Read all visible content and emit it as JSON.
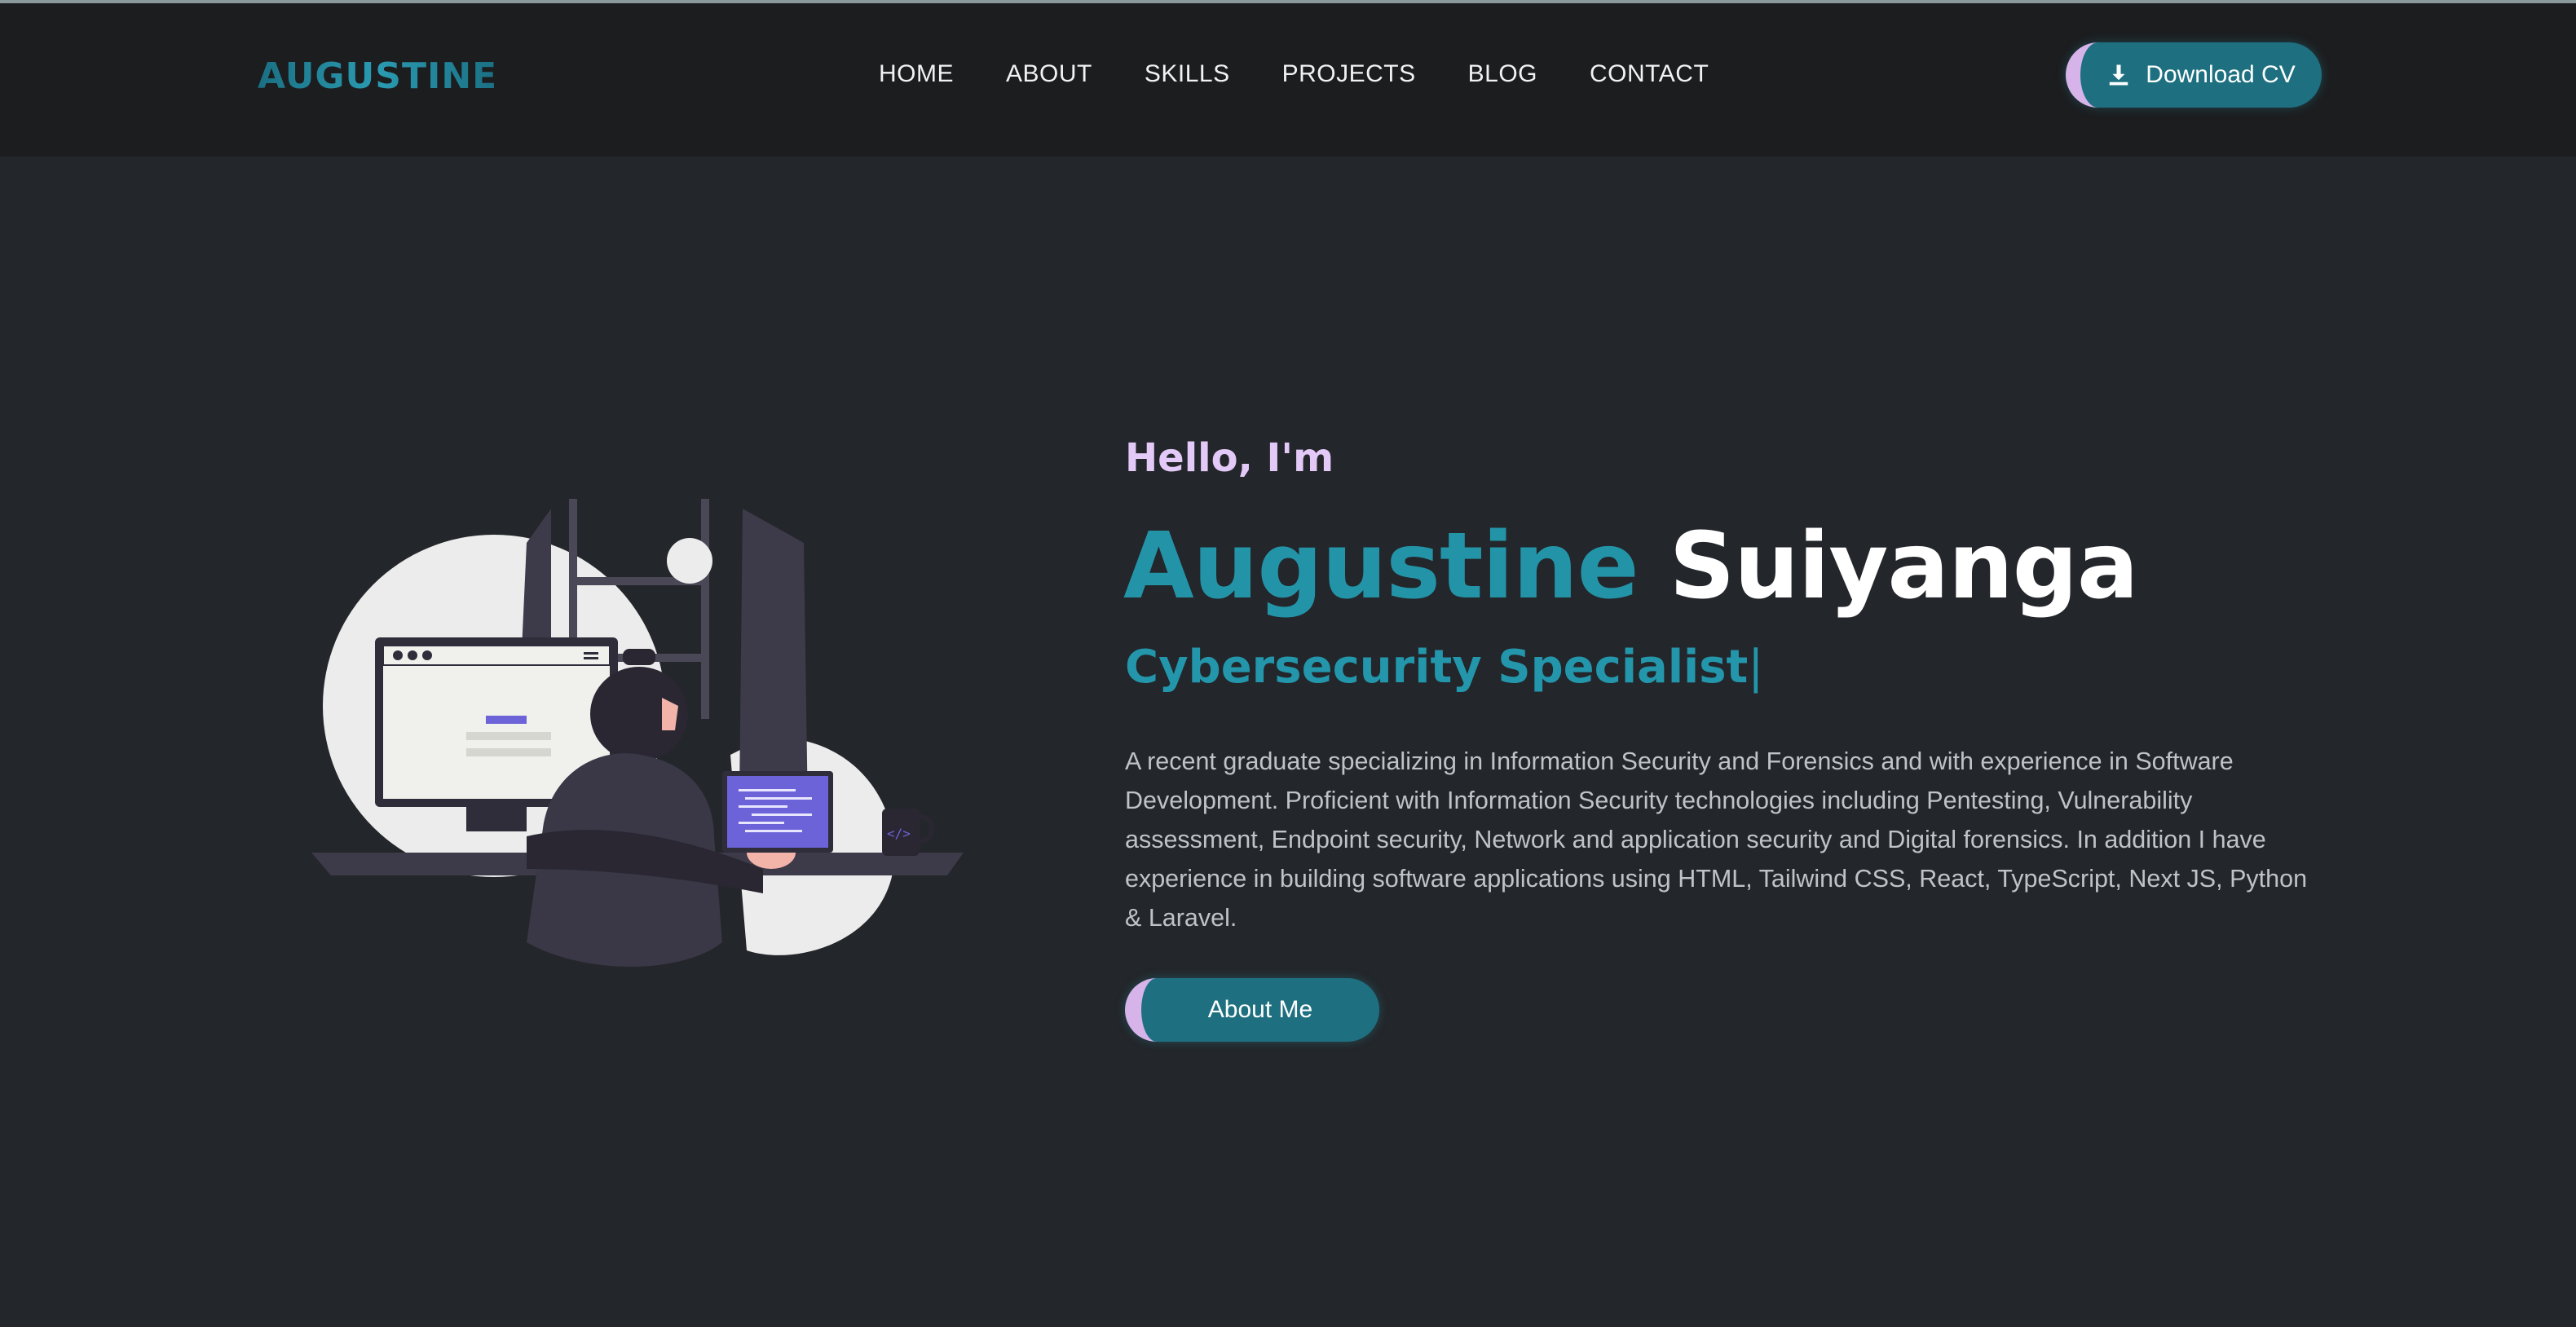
{
  "header": {
    "logo": "AUGUSTINE",
    "nav": [
      "HOME",
      "ABOUT",
      "SKILLS",
      "PROJECTS",
      "BLOG",
      "CONTACT"
    ],
    "cta_label": "Download CV",
    "cta_icon": "download-icon"
  },
  "hero": {
    "greeting": "Hello, I'm",
    "first_name": "Augustine",
    "last_name": "Suiyanga",
    "role": "Cybersecurity Specialist",
    "caret": "|",
    "bio": "A recent graduate specializing in Information Security and Forensics and with experience in Software Development. Proficient with Information Security technologies including Pentesting, Vulnerability assessment, Endpoint security, Network and application security and Digital forensics. In addition I have experience in building software applications using HTML, Tailwind CSS, React, TypeScript, Next JS, Python & Laravel.",
    "button_label": "About Me",
    "illustration": "developer-at-desk-illustration"
  },
  "colors": {
    "background": "#23262a",
    "header": "#1c1d1f",
    "accent_teal": "#2394a8",
    "accent_lavender": "#d6b4ea",
    "button": "#1e7080"
  }
}
